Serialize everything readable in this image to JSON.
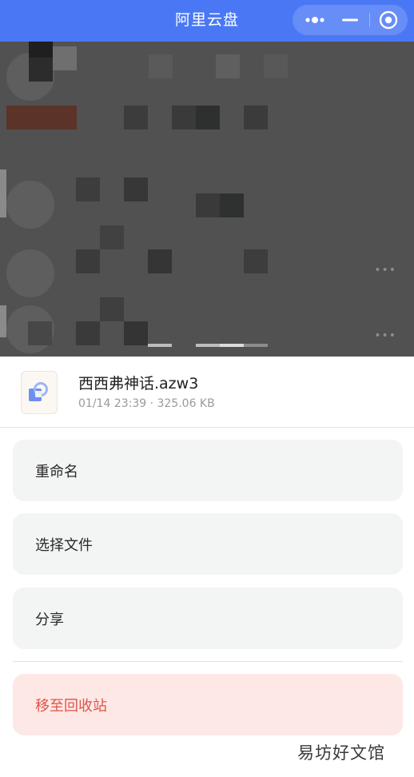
{
  "titlebar": {
    "title": "阿里云盘",
    "menu_icon": "more-dots-icon",
    "minimize_icon": "minimize-icon",
    "close_icon": "target-circle-icon",
    "background_color": "#4a78f5"
  },
  "file": {
    "name": "西西弗神话.azw3",
    "meta": "01/14 23:39 · 325.06 KB",
    "icon": "document-file-icon"
  },
  "actions": [
    {
      "label": "重命名",
      "kind": "normal"
    },
    {
      "label": "选择文件",
      "kind": "normal"
    },
    {
      "label": "分享",
      "kind": "normal"
    },
    {
      "label": "移至回收站",
      "kind": "danger"
    }
  ],
  "colors": {
    "danger_text": "#e2544a",
    "danger_bg": "#fde8e6",
    "action_bg": "#f3f4f4"
  },
  "watermark": "易坊好文馆"
}
